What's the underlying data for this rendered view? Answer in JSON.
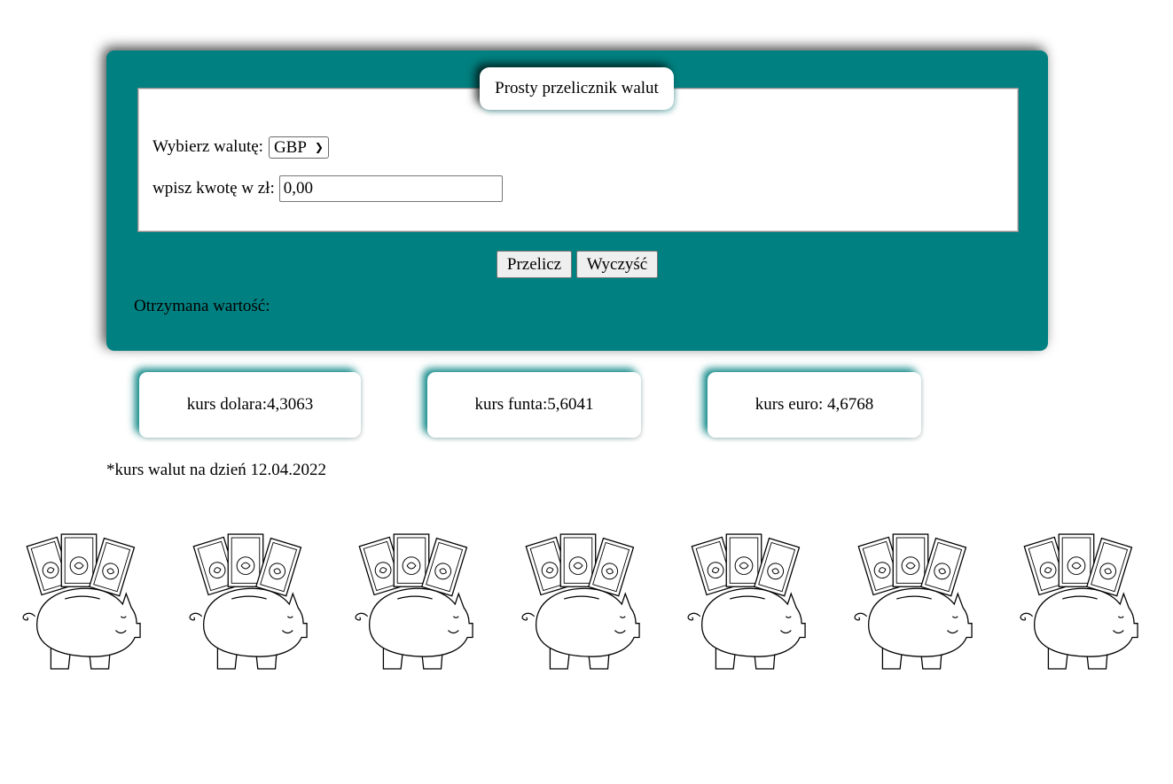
{
  "converter": {
    "legend": "Prosty przelicznik walut",
    "currency_label": "Wybierz walutę:",
    "currency_selected": "GBP",
    "amount_label": "wpisz kwotę w zł:",
    "amount_value": "0,00",
    "convert_button": "Przelicz",
    "clear_button": "Wyczyść",
    "result_label": "Otrzymana wartość:"
  },
  "rates": [
    {
      "label": "kurs dolara:4,3063"
    },
    {
      "label": "kurs funta:5,6041"
    },
    {
      "label": "kurs euro: 4,6768"
    }
  ],
  "note": "*kurs walut na dzień 12.04.2022",
  "images": {
    "pig_icon": "piggy-bank-with-banknotes-icon",
    "count": 7
  },
  "colors": {
    "panel": "#008080",
    "card_glow": "#008080"
  }
}
